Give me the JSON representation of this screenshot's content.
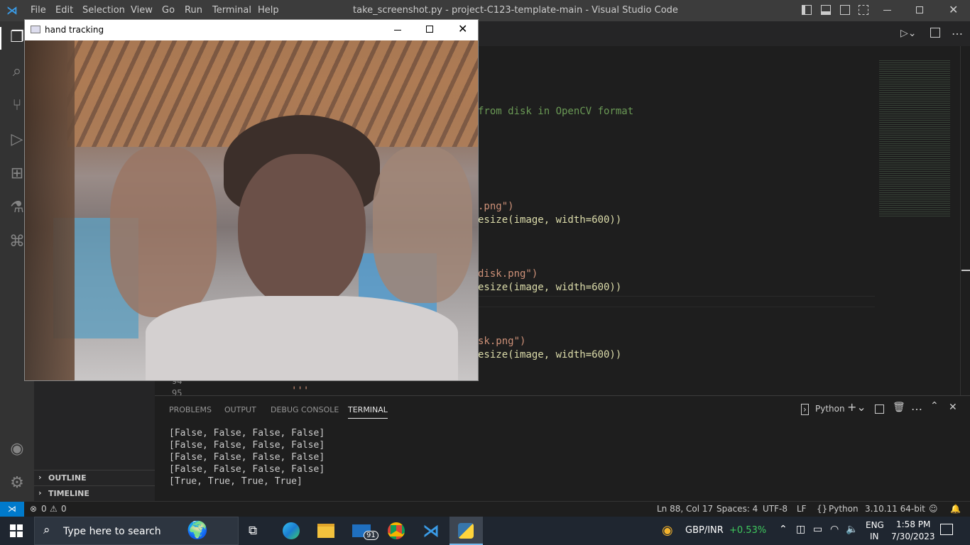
{
  "titlebar": {
    "menu": [
      "File",
      "Edit",
      "Selection",
      "View",
      "Go",
      "Run",
      "Terminal",
      "Help"
    ],
    "title": "take_screenshot.py - project-C123-template-main - Visual Studio Code"
  },
  "sidebar": {
    "outline_label": "OUTLINE",
    "timeline_label": "TIMELINE"
  },
  "editor": {
    "comment_line": "from disk in OpenCV format",
    "line1": ".png\")",
    "line2": "esize(image, width=600))",
    "line3": "disk.png\")",
    "line4": "esize(image, width=600))",
    "line5": "sk.png\")",
    "line6": "esize(image, width=600))",
    "line_numbers": [
      "94",
      "95"
    ],
    "dots": "'''"
  },
  "panel": {
    "tabs": [
      "PROBLEMS",
      "OUTPUT",
      "DEBUG CONSOLE",
      "TERMINAL"
    ],
    "active_tab": "TERMINAL",
    "terminal_label": "Python",
    "lines": [
      "[False, False, False, False]",
      "[False, False, False, False]",
      "[False, False, False, False]",
      "[False, False, False, False]",
      "[True, True, True, True]"
    ]
  },
  "statusbar": {
    "errors": "0",
    "warnings": "0",
    "position": "Ln 88, Col 17",
    "spaces": "Spaces: 4",
    "encoding": "UTF-8",
    "eol": "LF",
    "language": "Python",
    "interpreter": "3.10.11 64-bit"
  },
  "window": {
    "title": "hand tracking"
  },
  "taskbar": {
    "search_placeholder": "Type here to search",
    "mail_badge": "91",
    "ticker": "GBP/INR",
    "ticker_change": "+0.53%",
    "lang_top": "ENG",
    "lang_bottom": "IN",
    "time": "1:58 PM",
    "date": "7/30/2023"
  },
  "colors": {
    "accent_blue": "#007acc",
    "ticker_green": "#3fc85d",
    "comment_green": "#6a9955",
    "string_orange": "#ce9178",
    "variable_blue": "#9cdcfe",
    "function_yellow": "#dcdcaa"
  }
}
